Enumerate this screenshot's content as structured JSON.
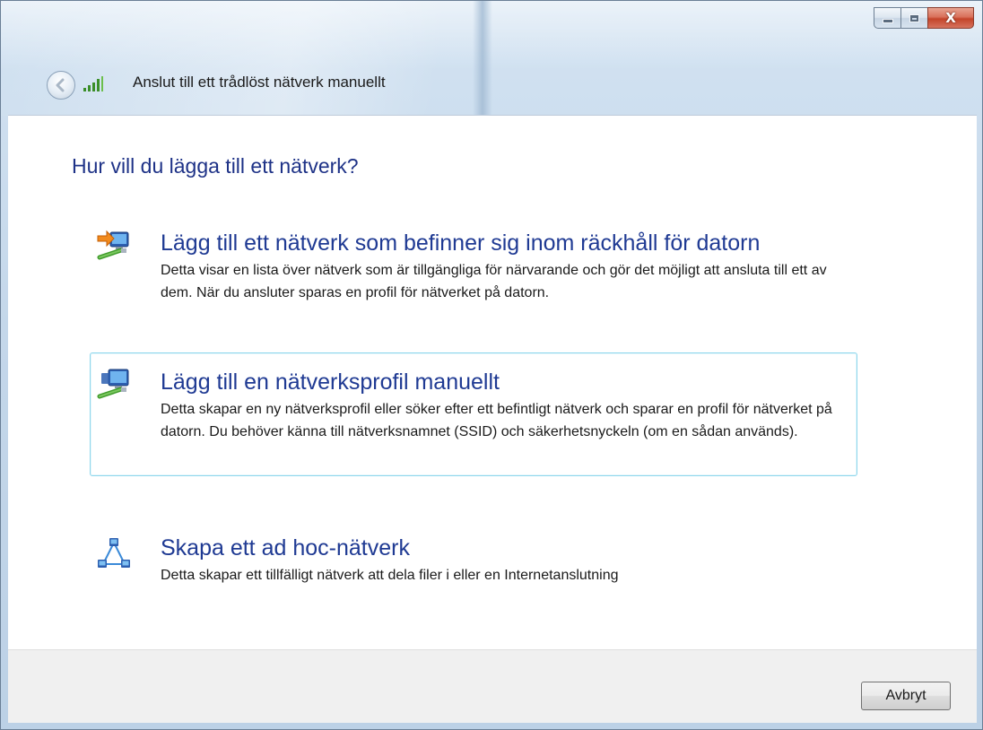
{
  "window": {
    "title": "Anslut till ett trådlöst nätverk manuellt",
    "minimize_icon": "minimize-icon",
    "maximize_icon": "maximize-icon",
    "close_label": "X"
  },
  "main": {
    "heading": "Hur vill du lägga till ett nätverk?",
    "options": [
      {
        "title": "Lägg till ett nätverk som befinner sig inom räckhåll för datorn",
        "description": "Detta visar en lista över nätverk som är tillgängliga för närvarande och gör det möjligt att ansluta till ett av dem. När du ansluter sparas en profil för nätverket på datorn.",
        "icon": "network-arrow-icon"
      },
      {
        "title": "Lägg till en nätverksprofil manuellt",
        "description": "Detta skapar en ny nätverksprofil eller söker efter ett befintligt nätverk och sparar en profil för nätverket på datorn. Du behöver känna till nätverksnamnet (SSID) och säkerhetsnyckeln (om en sådan används).",
        "icon": "network-computer-icon",
        "selected": true
      },
      {
        "title": "Skapa ett ad hoc-nätverk",
        "description": "Detta skapar ett tillfälligt nätverk att dela filer i eller en Internetanslutning",
        "icon": "adhoc-network-icon"
      }
    ]
  },
  "footer": {
    "cancel_label": "Avbryt"
  },
  "colors": {
    "heading": "#1e3287",
    "option_title": "#1f3a93",
    "selection_border": "#8fd7ec"
  }
}
